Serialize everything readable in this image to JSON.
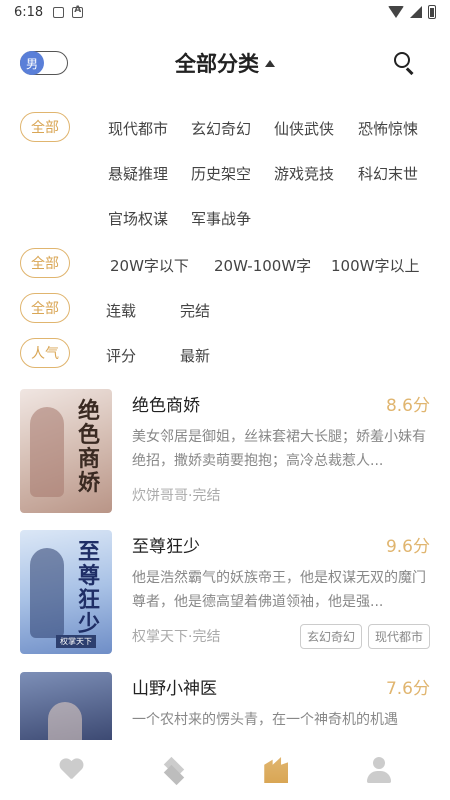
{
  "status_bar": {
    "time": "6:18"
  },
  "header": {
    "gender_toggle_label": "男",
    "title": "全部分类"
  },
  "filters": {
    "category": {
      "active": "全部",
      "options": [
        "现代都市",
        "玄幻奇幻",
        "仙侠武侠",
        "恐怖惊悚",
        "悬疑推理",
        "历史架空",
        "游戏竞技",
        "科幻末世",
        "官场权谋",
        "军事战争"
      ]
    },
    "word_count": {
      "active": "全部",
      "options": [
        "20W字以下",
        "20W-100W字",
        "100W字以上"
      ]
    },
    "status": {
      "active": "全部",
      "options": [
        "连载",
        "完结"
      ]
    },
    "sort": {
      "active": "人气",
      "options": [
        "评分",
        "最新"
      ]
    }
  },
  "books": [
    {
      "title": "绝色商娇",
      "score": "8.6分",
      "cover_title": "绝色商娇",
      "description": "美女邻居是御姐，丝袜套裙大长腿；娇羞小妹有绝招，撒娇卖萌要抱抱；高冷总裁惹人...",
      "meta": "炊饼哥哥·完结",
      "tags": []
    },
    {
      "title": "至尊狂少",
      "score": "9.6分",
      "cover_title": "至尊狂少",
      "cover_tag": "权掌天下",
      "description": "他是浩然霸气的妖族帝王，他是权谋无双的魔门尊者，他是德高望着佛道领袖，他是强...",
      "meta": "权掌天下·完结",
      "tags": [
        "玄幻奇幻",
        "现代都市"
      ]
    },
    {
      "title": "山野小神医",
      "score": "7.6分",
      "description": "一个农村来的愣头青，在一个神奇机的机遇",
      "meta": "",
      "tags": []
    }
  ],
  "bottom_nav": [
    "heart-icon",
    "layers-icon",
    "bookshelf-icon",
    "person-icon"
  ],
  "colors": {
    "accent": "#e0b56f",
    "toggle": "#5a7fd8"
  }
}
